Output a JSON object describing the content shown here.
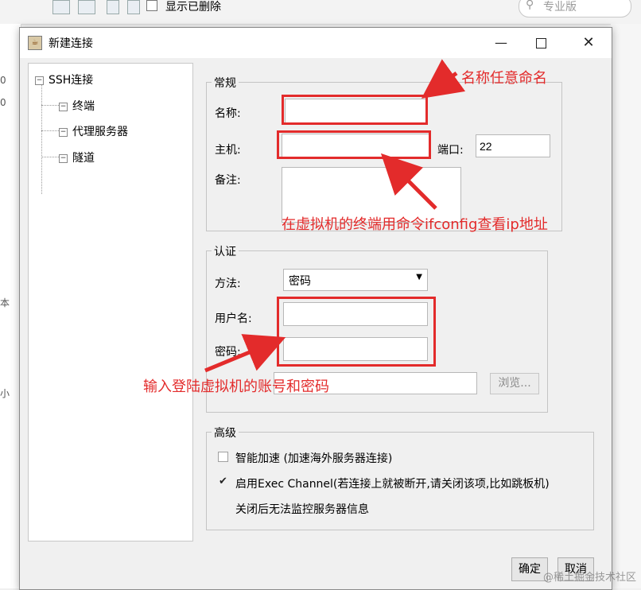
{
  "background": {
    "show_deleted_label": "显示已删除",
    "search_placeholder": "专业版",
    "left_rows": [
      "0",
      "0",
      "本",
      "小"
    ]
  },
  "dialog": {
    "title": "新建连接",
    "icons": {
      "app": "java-icon",
      "min": "minimize-icon",
      "max": "maximize-icon",
      "close": "close-icon"
    }
  },
  "tree": {
    "root": "SSH连接",
    "children": [
      "终端",
      "代理服务器",
      "隧道"
    ]
  },
  "general": {
    "legend": "常规",
    "name_label": "名称:",
    "name_value": "",
    "host_label": "主机:",
    "host_value": "",
    "port_label": "端口:",
    "port_value": "22",
    "note_label": "备注:",
    "note_value": ""
  },
  "auth": {
    "legend": "认证",
    "method_label": "方法:",
    "method_value": "密码",
    "username_label": "用户名:",
    "username_value": "",
    "password_label": "密码:",
    "password_value": "",
    "browse_label": "浏览..."
  },
  "advanced": {
    "legend": "高级",
    "smart_accel_label": "智能加速 (加速海外服务器连接)",
    "smart_accel_checked": false,
    "exec_channel_label": "启用Exec Channel(若连接上就被断开,请关闭该项,比如跳板机)",
    "exec_channel_checked": true,
    "exec_note": "关闭后无法监控服务器信息"
  },
  "footer": {
    "ok_label": "确定",
    "cancel_label": "取消"
  },
  "annotations": {
    "name_hint": "名称任意命名",
    "host_hint": "在虚拟机的终端用命令ifconfig查看ip地址",
    "credential_hint": "输入登陆虚拟机的账号和密码",
    "color": "#e32b2b"
  },
  "watermark": "@稀土掘金技术社区"
}
